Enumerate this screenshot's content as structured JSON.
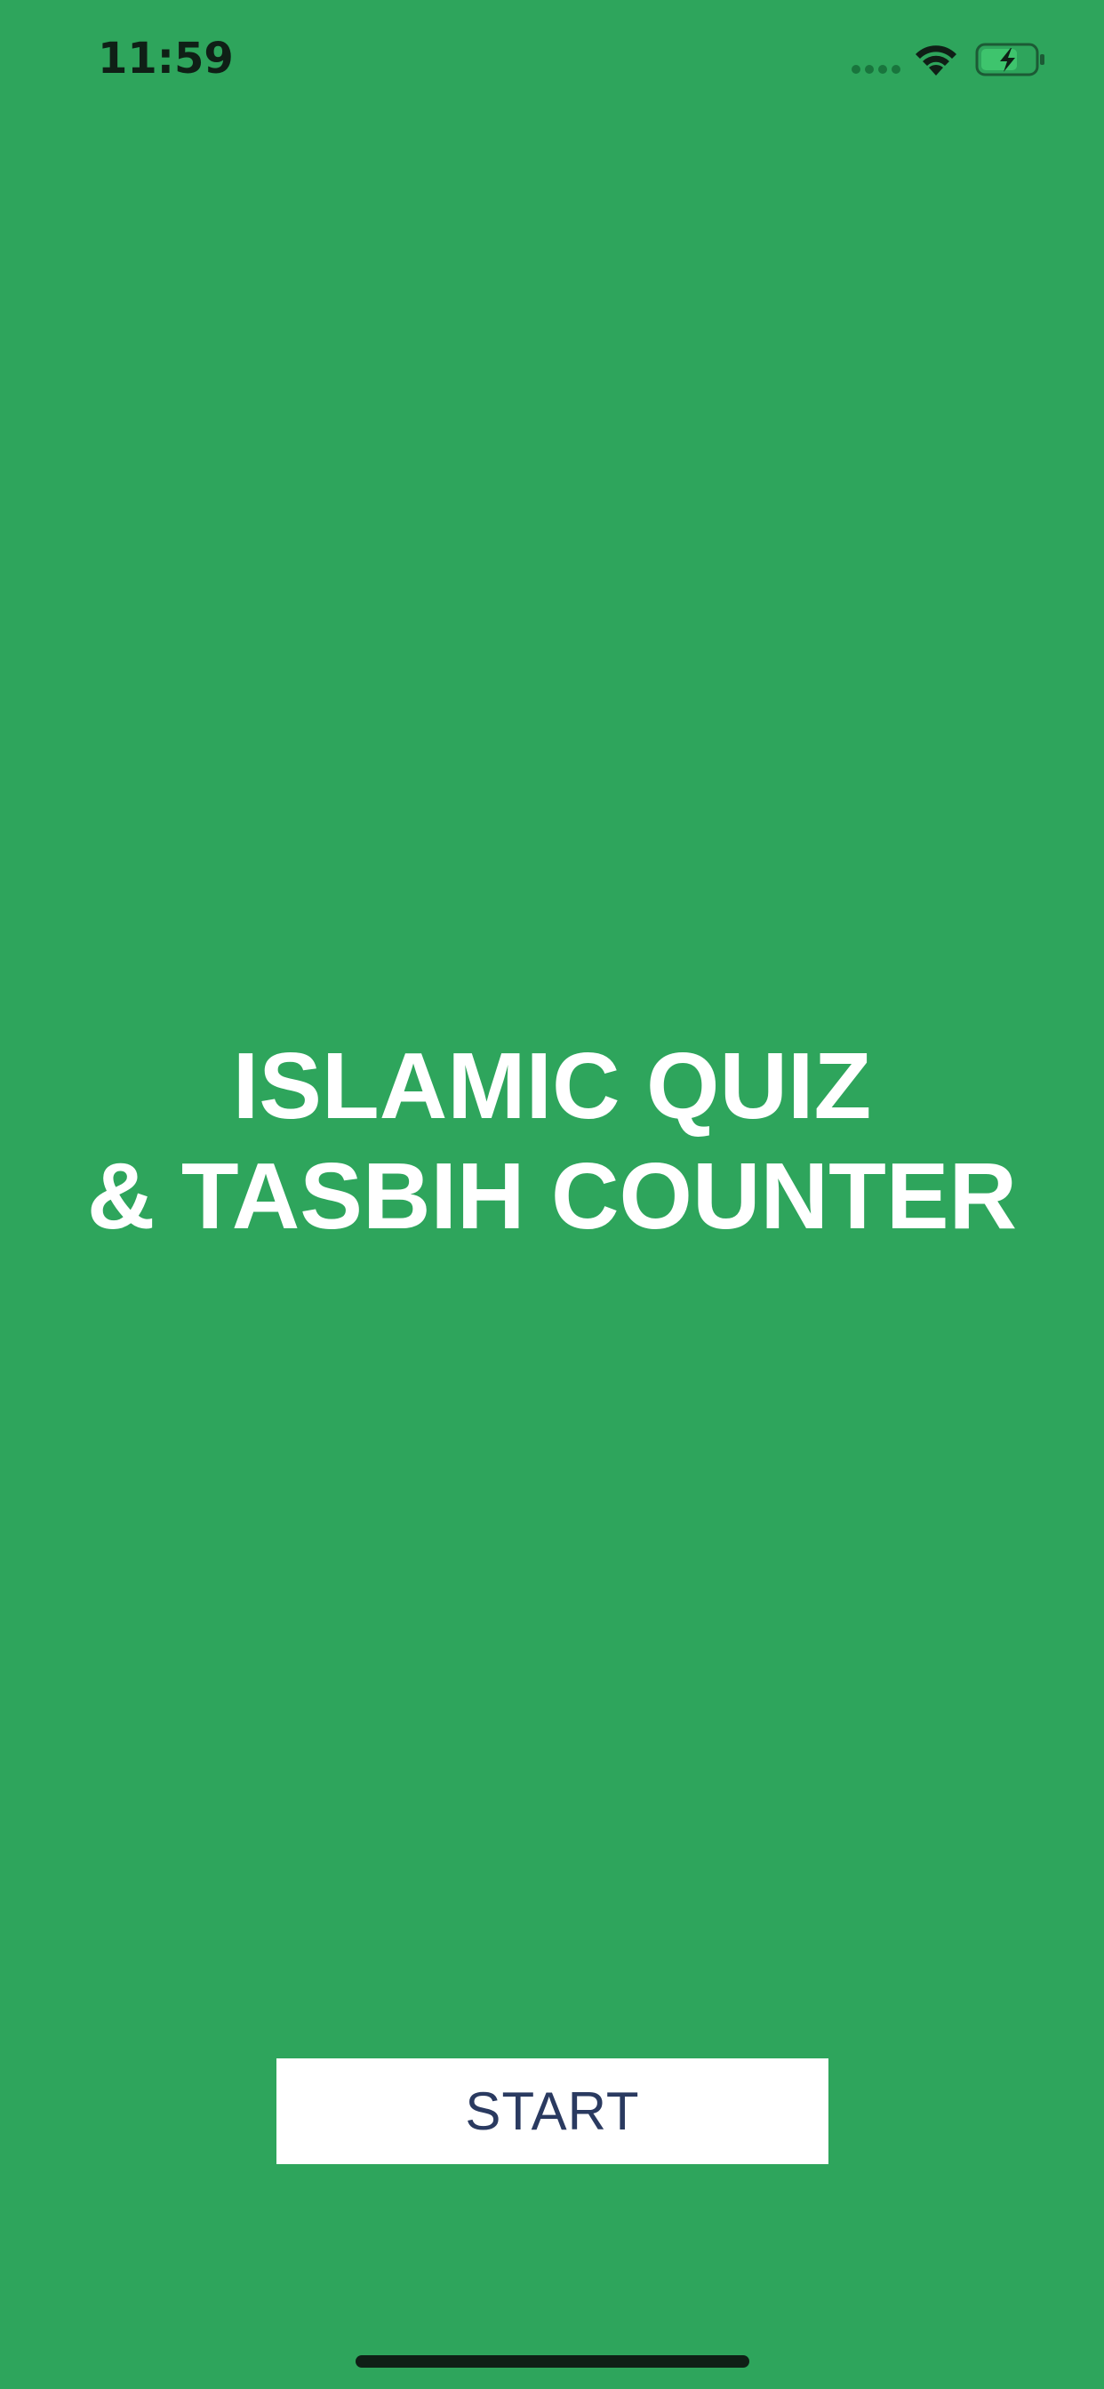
{
  "status_bar": {
    "time": "11:59"
  },
  "title": {
    "line1": "ISLAMIC QUIZ",
    "line2": "& TASBIH COUNTER"
  },
  "start_button": {
    "label": "START"
  },
  "colors": {
    "background": "#2ea55c",
    "title_text": "#ffffff",
    "button_background": "#ffffff",
    "button_text": "#2a3a60",
    "status_text": "#0f1f16"
  },
  "icons": {
    "signal": "signal-bars-icon",
    "wifi": "wifi-icon",
    "battery": "battery-charging-icon"
  }
}
